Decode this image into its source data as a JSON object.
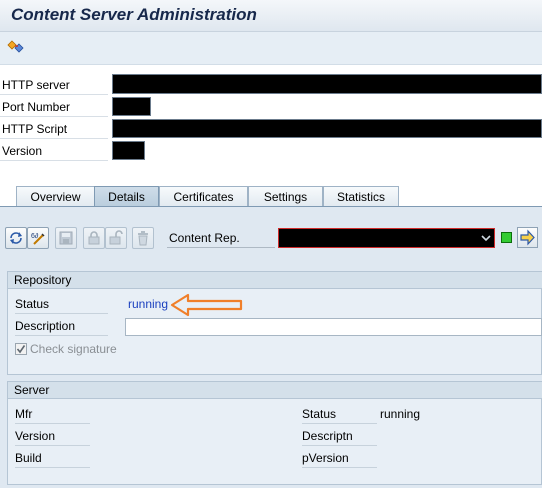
{
  "window": {
    "title": "Content Server Administration"
  },
  "toolbar": {
    "layout_icon": "layout-change-icon"
  },
  "header_fields": [
    {
      "label": "HTTP server"
    },
    {
      "label": "Port Number"
    },
    {
      "label": "HTTP Script"
    },
    {
      "label": "Version"
    }
  ],
  "tabs": [
    {
      "label": "Overview",
      "active": false
    },
    {
      "label": "Details",
      "active": true
    },
    {
      "label": "Certificates",
      "active": false
    },
    {
      "label": "Settings",
      "active": false
    },
    {
      "label": "Statistics",
      "active": false
    }
  ],
  "details_toolbar": {
    "icons": [
      "change-display-icon",
      "technical-info-icon",
      "save-icon",
      "lock-icon",
      "unlock-icon",
      "delete-icon"
    ],
    "content_rep_label": "Content Rep.",
    "status_light_color": "#33cc33",
    "go_icon": "next-arrow-icon"
  },
  "repository": {
    "title": "Repository",
    "status_label": "Status",
    "status_value": "running",
    "status_value_color": "#1a3fbf",
    "description_label": "Description",
    "check_signature_label": "Check signature",
    "check_signature_checked": true,
    "annotation_color": "#f07f2a"
  },
  "server": {
    "title": "Server",
    "left_fields": [
      {
        "label": "Mfr"
      },
      {
        "label": "Version"
      },
      {
        "label": "Build"
      }
    ],
    "right_fields": [
      {
        "label": "Status",
        "value": "running"
      },
      {
        "label": "Descriptn",
        "value": ""
      },
      {
        "label": "pVersion",
        "value": ""
      }
    ]
  }
}
